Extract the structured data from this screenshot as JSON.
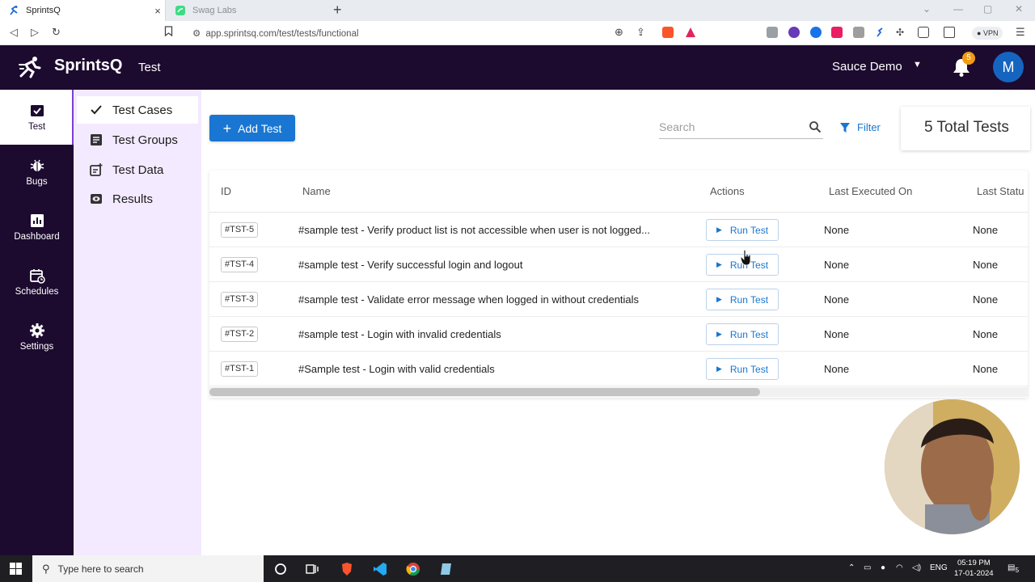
{
  "browser": {
    "tabs": [
      {
        "title": "SprintsQ",
        "active": true,
        "close": "×"
      },
      {
        "title": "Swag Labs",
        "active": false
      }
    ],
    "newtab": "+",
    "url": "app.sprintsq.com/test/tests/functional",
    "vpn": "VPN"
  },
  "header": {
    "brand": "SprintsQ",
    "module": "Test",
    "project": "Sauce Demo",
    "notification_count": "5",
    "avatar_initial": "M"
  },
  "rail": {
    "items": [
      {
        "label": "Test",
        "icon": "checklist-icon",
        "active": true
      },
      {
        "label": "Bugs",
        "icon": "bug-icon"
      },
      {
        "label": "Dashboard",
        "icon": "chart-icon"
      },
      {
        "label": "Schedules",
        "icon": "calendar-icon"
      },
      {
        "label": "Settings",
        "icon": "gear-icon"
      }
    ]
  },
  "subnav": {
    "items": [
      {
        "label": "Test Cases",
        "icon": "check-icon",
        "active": true
      },
      {
        "label": "Test Groups",
        "icon": "list-icon"
      },
      {
        "label": "Test Data",
        "icon": "add-note-icon"
      },
      {
        "label": "Results",
        "icon": "eye-icon"
      }
    ]
  },
  "toolbar": {
    "add_label": "Add Test",
    "search_placeholder": "Search",
    "filter_label": "Filter",
    "total_label": "5 Total Tests"
  },
  "table": {
    "columns": [
      "ID",
      "Name",
      "Actions",
      "Last Executed On",
      "Last Statu"
    ],
    "run_label": "Run Test",
    "rows": [
      {
        "id": "#TST-5",
        "name": "#sample test - Verify product list is not accessible when user is not logged...",
        "last_executed": "None",
        "last_status": "None"
      },
      {
        "id": "#TST-4",
        "name": "#sample test - Verify successful login and logout",
        "last_executed": "None",
        "last_status": "None"
      },
      {
        "id": "#TST-3",
        "name": "#sample test - Validate error message when logged in without credentials",
        "last_executed": "None",
        "last_status": "None"
      },
      {
        "id": "#TST-2",
        "name": "#sample test - Login with invalid credentials",
        "last_executed": "None",
        "last_status": "None"
      },
      {
        "id": "#TST-1",
        "name": "#Sample test - Login with valid credentials",
        "last_executed": "None",
        "last_status": "None"
      }
    ]
  },
  "taskbar": {
    "search_placeholder": "Type here to search",
    "lang": "ENG",
    "time": "05:19 PM",
    "date": "17-01-2024",
    "notif_count": "5"
  },
  "colors": {
    "header_bg": "#1c0a2f",
    "subnav_bg": "#f3eaff",
    "accent": "#1976d2",
    "badge": "#f39c12"
  }
}
